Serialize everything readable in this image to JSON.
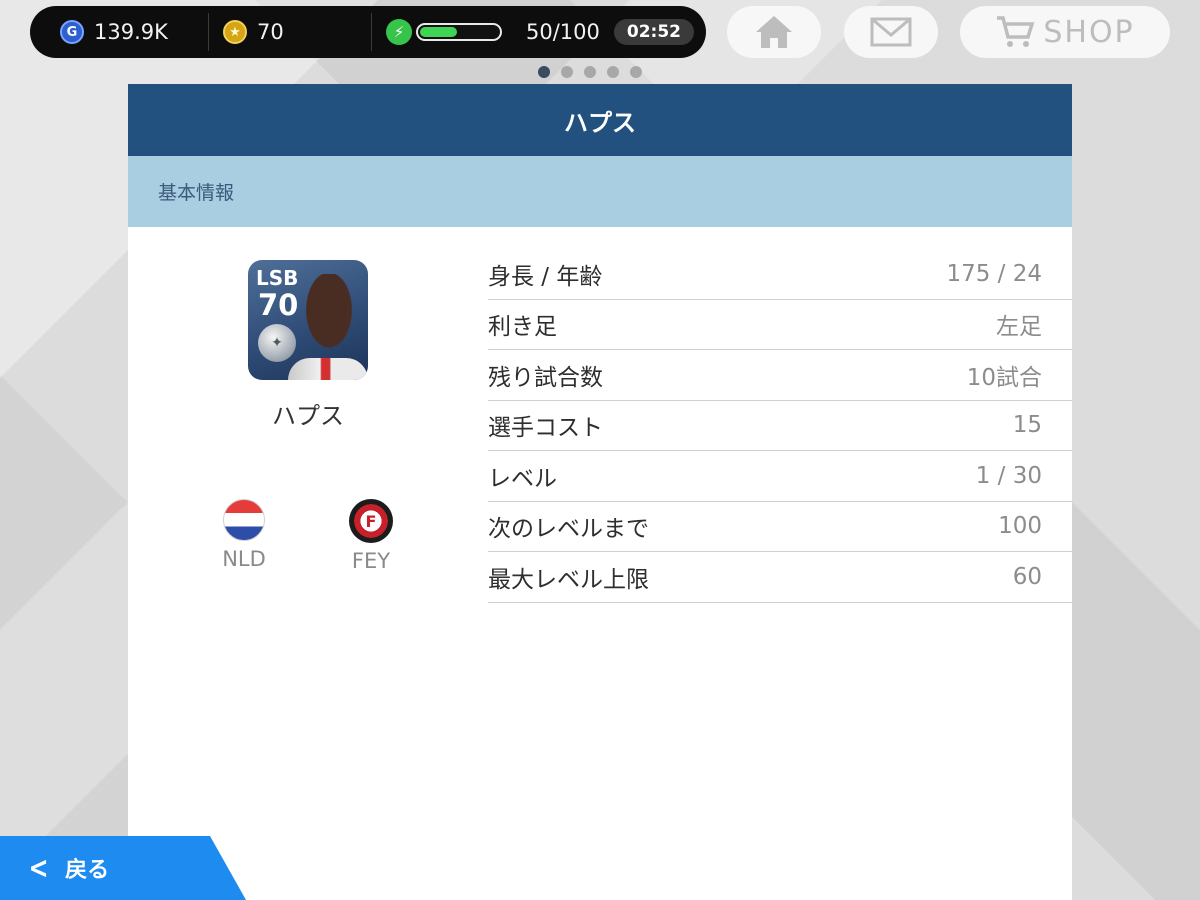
{
  "status": {
    "gp_icon": "G",
    "gp_value": "139.9K",
    "coin_icon": "★",
    "coin_value": "70",
    "energy_icon": "⚡",
    "energy_value": "50/100",
    "energy_fraction": 0.5,
    "timer": "02:52"
  },
  "nav": {
    "home_icon": "home-icon",
    "mail_icon": "mail-icon",
    "shop_label": "SHOP"
  },
  "pager": {
    "total": 5,
    "active": 0
  },
  "panel": {
    "title": "ハプス",
    "section": "基本情報"
  },
  "player": {
    "position": "LSB",
    "rating": "70",
    "name": "ハプス",
    "nation_code": "NLD",
    "club_code": "FEY",
    "colors": {
      "nation": [
        "#e53b3b",
        "#ffffff",
        "#2c4ea8"
      ],
      "club": "#c8202a"
    }
  },
  "info_rows": [
    {
      "label": "身長 / 年齢",
      "value": "175 / 24"
    },
    {
      "label": "利き足",
      "value": "左足"
    },
    {
      "label": "残り試合数",
      "value": "10試合"
    },
    {
      "label": "選手コスト",
      "value": "15"
    },
    {
      "label": "レベル",
      "value": "1 / 30"
    },
    {
      "label": "次のレベルまで",
      "value": "100"
    },
    {
      "label": "最大レベル上限",
      "value": "60"
    }
  ],
  "back": {
    "label": "戻る",
    "icon": "chevron-left-icon"
  },
  "colors": {
    "header": "#22507f",
    "section": "#a9cde1",
    "back_button": "#1d8bf0",
    "energy": "#3fd454"
  }
}
